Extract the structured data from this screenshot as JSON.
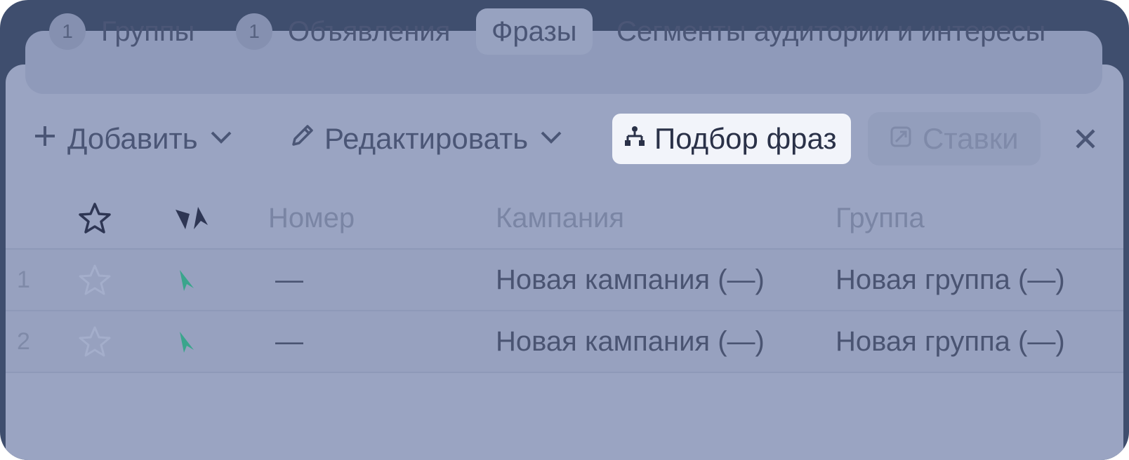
{
  "tabs": [
    {
      "count": "1",
      "label": "Группы"
    },
    {
      "count": "1",
      "label": "Объявления"
    },
    {
      "label": "Фразы"
    },
    {
      "label": "Сегменты аудитории и интересы"
    }
  ],
  "toolbar": {
    "add_label": "Добавить",
    "edit_label": "Редактировать",
    "phrase_selection_label": "Подбор фраз",
    "bids_label": "Ставки"
  },
  "table": {
    "headers": {
      "number": "Номер",
      "campaign": "Кампания",
      "group": "Группа"
    },
    "rows": [
      {
        "index": "1",
        "number": "—",
        "campaign": "Новая кампания (—)",
        "group": "Новая группа (—)"
      },
      {
        "index": "2",
        "number": "—",
        "campaign": "Новая кампания (—)",
        "group": "Новая группа (—)"
      }
    ]
  },
  "colors": {
    "frame": "#3f4e6e",
    "panel": "#9aa4c2",
    "highlight": "#f2f4fa",
    "status_green": "#3aa58c"
  }
}
